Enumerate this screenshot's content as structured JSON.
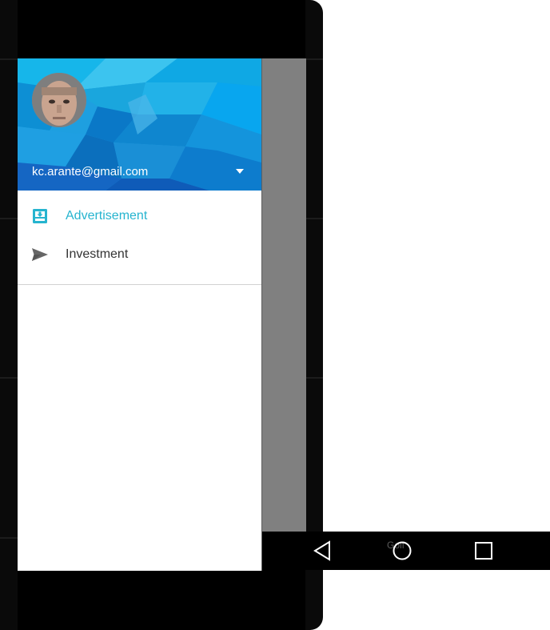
{
  "drawer": {
    "account_email": "kc.arante@gmail.com",
    "items": [
      {
        "label": "Advertisement",
        "icon": "inbox-download-icon",
        "active": true
      },
      {
        "label": "Investment",
        "icon": "send-icon",
        "active": false
      }
    ]
  },
  "nav_bar": {
    "hint_text": "Golf",
    "buttons": [
      "back-triangle-icon",
      "home-circle-icon",
      "recents-square-icon"
    ]
  },
  "colors": {
    "accent": "#26b4cf",
    "header_blue": "#1e9fe0",
    "scrim": "#808080",
    "icon_gray": "#666666"
  }
}
